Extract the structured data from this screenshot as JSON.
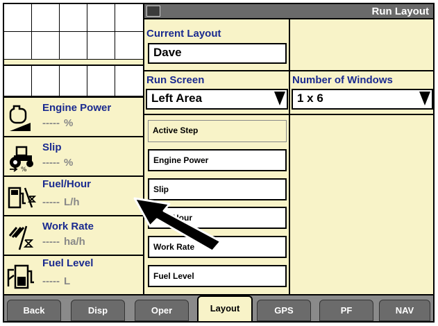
{
  "window": {
    "title": "Run Layout",
    "app_icon": "display-icon"
  },
  "current_layout": {
    "label": "Current Layout",
    "value": "Dave"
  },
  "run_screen": {
    "label": "Run Screen",
    "value": "Left Area"
  },
  "windows": {
    "label": "Number of Windows",
    "value": "1 x 6"
  },
  "steps": [
    {
      "label": "Active Step"
    },
    {
      "label": "Engine Power"
    },
    {
      "label": "Slip"
    },
    {
      "label": "Fuel/Hour"
    },
    {
      "label": "Work Rate"
    },
    {
      "label": "Fuel Level"
    }
  ],
  "readouts": [
    {
      "name": "Engine Power",
      "value": "-----",
      "unit": "%",
      "icon": "engine-power-icon"
    },
    {
      "name": "Slip",
      "value": "-----",
      "unit": "%",
      "icon": "tractor-slip-icon"
    },
    {
      "name": "Fuel/Hour",
      "value": "-----",
      "unit": "L/h",
      "icon": "fuel-hour-icon"
    },
    {
      "name": "Work Rate",
      "value": "-----",
      "unit": "ha/h",
      "icon": "work-rate-icon"
    },
    {
      "name": "Fuel Level",
      "value": "-----",
      "unit": "L",
      "icon": "fuel-level-icon"
    }
  ],
  "tabs": [
    {
      "label": "Back"
    },
    {
      "label": "Disp"
    },
    {
      "label": "Oper"
    },
    {
      "label": "Layout",
      "active": true
    },
    {
      "label": "GPS"
    },
    {
      "label": "PF"
    },
    {
      "label": "NAV"
    }
  ],
  "colors": {
    "panel": "#f8f3c8",
    "title_bar": "#6a6a6a",
    "label_blue": "#1a2a8f",
    "tab_bar": "#8a8a8a"
  }
}
